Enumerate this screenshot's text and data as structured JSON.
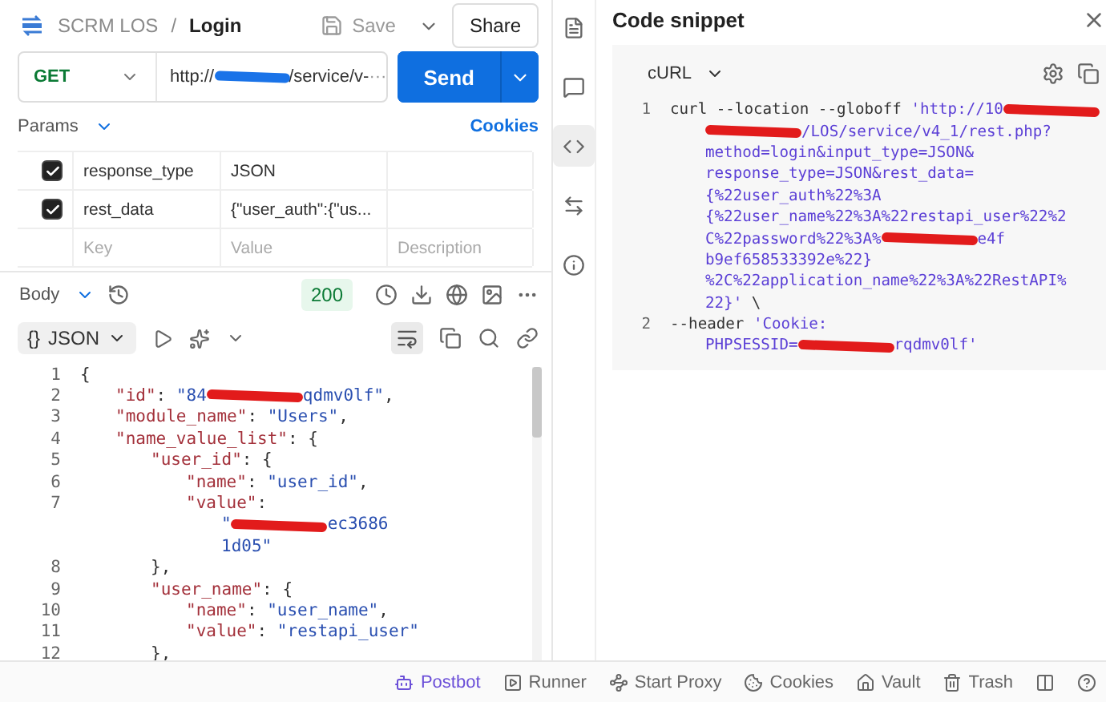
{
  "breadcrumb": {
    "collection": "SCRM LOS",
    "separator": "/",
    "request": "Login"
  },
  "header_actions": {
    "save": "Save",
    "share": "Share"
  },
  "request": {
    "method": "GET",
    "url": "http://",
    "url_tail": "/service/v-",
    "url_more": "···",
    "send": "Send"
  },
  "params": {
    "label": "Params",
    "cookies": "Cookies",
    "rows": [
      {
        "checked": true,
        "key": "response_type",
        "value": "JSON"
      },
      {
        "checked": true,
        "key": "rest_data",
        "value": "{\"user_auth\":{\"us..."
      }
    ],
    "placeholder": {
      "key": "Key",
      "value": "Value",
      "description": "Description"
    }
  },
  "response": {
    "tab": "Body",
    "status": "200",
    "format_braces": "{}",
    "format": "JSON",
    "lines": [
      {
        "num": "1",
        "tokens": [
          {
            "kind": "punct",
            "text": "{"
          }
        ],
        "children": [
          {
            "num": "2",
            "tokens": [
              {
                "kind": "key",
                "text": "\"id\""
              },
              {
                "kind": "punct",
                "text": ": "
              },
              {
                "kind": "string",
                "text": "\"84"
              },
              {
                "kind": "redacted"
              },
              {
                "kind": "string",
                "text": "qdmv0lf\""
              },
              {
                "kind": "punct",
                "text": ","
              }
            ]
          },
          {
            "num": "3",
            "tokens": [
              {
                "kind": "key",
                "text": "\"module_name\""
              },
              {
                "kind": "punct",
                "text": ": "
              },
              {
                "kind": "string",
                "text": "\"Users\""
              },
              {
                "kind": "punct",
                "text": ","
              }
            ]
          },
          {
            "num": "4",
            "tokens": [
              {
                "kind": "key",
                "text": "\"name_value_list\""
              },
              {
                "kind": "punct",
                "text": ": {"
              }
            ],
            "children": [
              {
                "num": "5",
                "tokens": [
                  {
                    "kind": "key",
                    "text": "\"user_id\""
                  },
                  {
                    "kind": "punct",
                    "text": ": {"
                  }
                ],
                "children": [
                  {
                    "num": "6",
                    "tokens": [
                      {
                        "kind": "key",
                        "text": "\"name\""
                      },
                      {
                        "kind": "punct",
                        "text": ": "
                      },
                      {
                        "kind": "string",
                        "text": "\"user_id\""
                      },
                      {
                        "kind": "punct",
                        "text": ","
                      }
                    ]
                  },
                  {
                    "num": "7",
                    "tokens": [
                      {
                        "kind": "key",
                        "text": "\"value\""
                      },
                      {
                        "kind": "punct",
                        "text": ":"
                      }
                    ],
                    "wrapped": [
                      {
                        "tokens": [
                          {
                            "kind": "string",
                            "text": "\""
                          },
                          {
                            "kind": "redacted"
                          },
                          {
                            "kind": "string",
                            "text": "ec3686"
                          }
                        ]
                      },
                      {
                        "tokens": [
                          {
                            "kind": "string",
                            "text": "1d05\""
                          }
                        ]
                      }
                    ]
                  }
                ]
              },
              {
                "num": "8",
                "tokens": [
                  {
                    "kind": "punct",
                    "text": "},"
                  }
                ]
              },
              {
                "num": "9",
                "tokens": [
                  {
                    "kind": "key",
                    "text": "\"user_name\""
                  },
                  {
                    "kind": "punct",
                    "text": ": {"
                  }
                ],
                "children": [
                  {
                    "num": "10",
                    "tokens": [
                      {
                        "kind": "key",
                        "text": "\"name\""
                      },
                      {
                        "kind": "punct",
                        "text": ": "
                      },
                      {
                        "kind": "string",
                        "text": "\"user_name\""
                      },
                      {
                        "kind": "punct",
                        "text": ","
                      }
                    ]
                  },
                  {
                    "num": "11",
                    "tokens": [
                      {
                        "kind": "key",
                        "text": "\"value\""
                      },
                      {
                        "kind": "punct",
                        "text": ": "
                      },
                      {
                        "kind": "string",
                        "text": "\"restapi_user\""
                      }
                    ]
                  }
                ]
              },
              {
                "num": "12",
                "tokens": [
                  {
                    "kind": "punct",
                    "text": "},"
                  }
                ]
              }
            ]
          }
        ]
      }
    ]
  },
  "rail": [
    {
      "kind": "docs",
      "selected": false
    },
    {
      "kind": "comments",
      "selected": false
    },
    {
      "kind": "code",
      "selected": true
    },
    {
      "kind": "related",
      "selected": false
    },
    {
      "kind": "info",
      "selected": false
    }
  ],
  "snippet": {
    "title": "Code snippet",
    "language": "cURL",
    "lines": [
      {
        "num": "1",
        "tokens": [
          {
            "kind": "plain",
            "text": "curl --location --globoff "
          },
          {
            "kind": "url",
            "text": "'http://10"
          },
          {
            "kind": "redacted"
          }
        ],
        "wrapped": [
          {
            "tokens": [
              {
                "kind": "redacted"
              },
              {
                "kind": "url",
                "text": "/LOS/service/v4_1/rest.php?"
              }
            ]
          },
          {
            "tokens": [
              {
                "kind": "url",
                "text": "method=login&input_type=JSON&"
              }
            ]
          },
          {
            "tokens": [
              {
                "kind": "url",
                "text": "response_type=JSON&rest_data="
              }
            ]
          },
          {
            "tokens": [
              {
                "kind": "url",
                "text": "{%22user_auth%22%3A"
              }
            ]
          },
          {
            "tokens": [
              {
                "kind": "url",
                "text": "{%22user_name%22%3A%22restapi_user%22%2"
              }
            ]
          },
          {
            "tokens": [
              {
                "kind": "url",
                "text": "C%22password%22%3A%"
              },
              {
                "kind": "redacted"
              },
              {
                "kind": "url",
                "text": "e4f"
              }
            ]
          },
          {
            "tokens": [
              {
                "kind": "url",
                "text": "b9ef658533392e%22}"
              }
            ]
          },
          {
            "tokens": [
              {
                "kind": "url",
                "text": "%2C%22application_name%22%3A%22RestAPI%"
              }
            ]
          },
          {
            "tokens": [
              {
                "kind": "url",
                "text": "22}'"
              },
              {
                "kind": "plain",
                "text": " \\"
              }
            ]
          }
        ]
      },
      {
        "num": "2",
        "tokens": [
          {
            "kind": "plain",
            "text": "--header "
          },
          {
            "kind": "url",
            "text": "'Cookie:"
          }
        ],
        "wrapped": [
          {
            "tokens": [
              {
                "kind": "url",
                "text": "PHPSESSID="
              },
              {
                "kind": "redacted"
              },
              {
                "kind": "url",
                "text": "rqdmv0lf'"
              }
            ]
          }
        ]
      }
    ]
  },
  "status_bar": [
    {
      "kind": "postbot",
      "label": "Postbot"
    },
    {
      "kind": "runner",
      "label": "Runner"
    },
    {
      "kind": "proxy",
      "label": "Start Proxy"
    },
    {
      "kind": "cookies",
      "label": "Cookies"
    },
    {
      "kind": "vault",
      "label": "Vault"
    },
    {
      "kind": "trash",
      "label": "Trash"
    },
    {
      "kind": "layout"
    },
    {
      "kind": "help"
    }
  ]
}
